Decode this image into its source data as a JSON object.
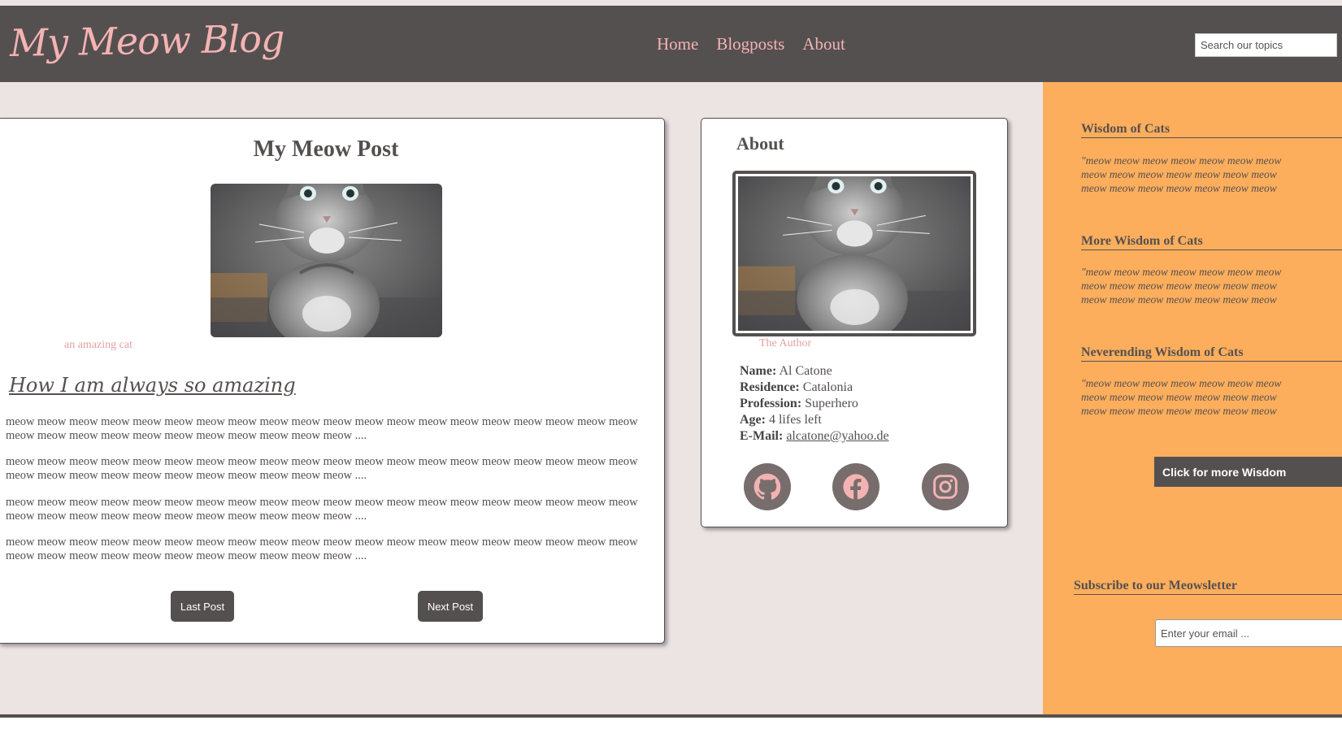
{
  "header": {
    "logo": "My Meow Blog",
    "nav": [
      "Home",
      "Blogposts",
      "About"
    ],
    "search_placeholder": "Search our topics"
  },
  "post": {
    "title": "My Meow Post",
    "image_caption": "an amazing cat",
    "subtitle": "How I am always so amazing",
    "paragraphs": [
      "meow meow meow meow meow meow meow meow meow meow meow meow meow meow meow meow meow meow meow meow meow meow meow meow meow meow meow meow meow meow meow ....",
      "meow meow meow meow meow meow meow meow meow meow meow meow meow meow meow meow meow meow meow meow meow meow meow meow meow meow meow meow meow meow meow ....",
      "meow meow meow meow meow meow meow meow meow meow meow meow meow meow meow meow meow meow meow meow meow meow meow meow meow meow meow meow meow meow meow ....",
      "meow meow meow meow meow meow meow meow meow meow meow meow meow meow meow meow meow meow meow meow meow meow meow meow meow meow meow meow meow meow meow ...."
    ],
    "last_button": "Last Post",
    "next_button": "Next Post"
  },
  "about": {
    "title": "About",
    "image_caption": "The Author",
    "fields": [
      {
        "label": "Name:",
        "value": "Al Catone"
      },
      {
        "label": "Residence:",
        "value": "Catalonia"
      },
      {
        "label": "Profession:",
        "value": "Superhero"
      },
      {
        "label": "Age:",
        "value": "4 lifes left"
      }
    ],
    "email_label": "E-Mail:",
    "email": "alcatone@yahoo.de",
    "social_icons": [
      "github-icon",
      "facebook-icon",
      "instagram-icon"
    ]
  },
  "sidebar": {
    "sections": [
      {
        "heading": "Wisdom of Cats",
        "text": "\"meow meow meow meow meow meow meow\nmeow meow meow meow meow meow meow\nmeow meow meow meow meow meow meow"
      },
      {
        "heading": "More Wisdom of Cats",
        "text": "\"meow meow meow meow meow meow meow\nmeow meow meow meow meow meow meow\nmeow meow meow meow meow meow meow"
      },
      {
        "heading": "Neverending Wisdom of Cats",
        "text": "\"meow meow meow meow meow meow meow\nmeow meow meow meow meow meow meow\nmeow meow meow meow meow meow meow"
      }
    ],
    "more_button": "Click for more Wisdom",
    "subscribe_heading": "Subscribe to our Meowsletter",
    "email_placeholder": "Enter your email ..."
  },
  "colors": {
    "header_bg": "#555050",
    "accent_pink": "#f4b3b3",
    "sidebar_bg": "#fdae5c",
    "page_bg": "#ece3e3"
  }
}
